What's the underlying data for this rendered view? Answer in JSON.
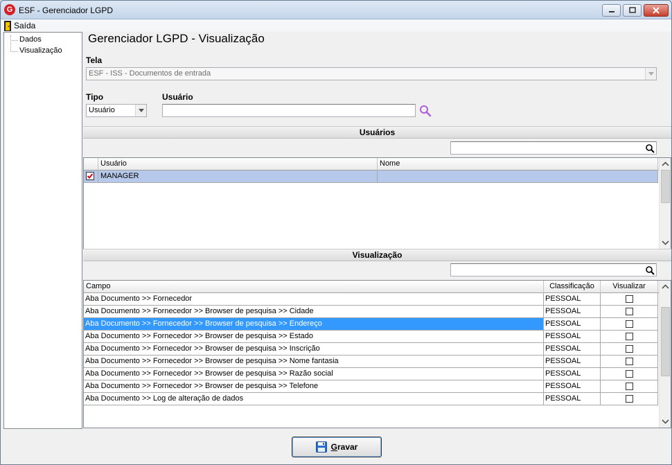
{
  "window": {
    "title": "ESF - Gerenciador LGPD",
    "app_icon_letter": "G"
  },
  "menu": {
    "exit_label": "Saída"
  },
  "tree": {
    "items": [
      {
        "label": "Dados"
      },
      {
        "label": "Visualização"
      }
    ]
  },
  "page": {
    "title": "Gerenciador LGPD - Visualização"
  },
  "form": {
    "tela_label": "Tela",
    "tela_value": "ESF - ISS - Documentos de entrada",
    "tipo_label": "Tipo",
    "tipo_value": "Usuário",
    "usuario_label": "Usuário",
    "usuario_value": ""
  },
  "users_section": {
    "title": "Usuários",
    "filter_value": "",
    "columns": [
      "Usuário",
      "Nome"
    ],
    "rows": [
      {
        "usuario": "MANAGER",
        "nome": "",
        "checked": true
      }
    ]
  },
  "view_section": {
    "title": "Visualização",
    "filter_value": "",
    "columns": [
      "Campo",
      "Classificação",
      "Visualizar"
    ],
    "rows": [
      {
        "campo": "Aba Documento >> Fornecedor",
        "classificacao": "PESSOAL",
        "visualizar": false
      },
      {
        "campo": "Aba Documento >> Fornecedor >> Browser de pesquisa >> Cidade",
        "classificacao": "PESSOAL",
        "visualizar": false
      },
      {
        "campo": "Aba Documento >> Fornecedor >> Browser de pesquisa >> Endereço",
        "classificacao": "PESSOAL",
        "visualizar": false
      },
      {
        "campo": "Aba Documento >> Fornecedor >> Browser de pesquisa >> Estado",
        "classificacao": "PESSOAL",
        "visualizar": false
      },
      {
        "campo": "Aba Documento >> Fornecedor >> Browser de pesquisa >> Inscrição",
        "classificacao": "PESSOAL",
        "visualizar": false
      },
      {
        "campo": "Aba Documento >> Fornecedor >> Browser de pesquisa >> Nome fantasia",
        "classificacao": "PESSOAL",
        "visualizar": false
      },
      {
        "campo": "Aba Documento >> Fornecedor >> Browser de pesquisa >> Razão social",
        "classificacao": "PESSOAL",
        "visualizar": false
      },
      {
        "campo": "Aba Documento >> Fornecedor >> Browser de pesquisa >> Telefone",
        "classificacao": "PESSOAL",
        "visualizar": false
      },
      {
        "campo": "Aba Documento >> Log de alteração de dados",
        "classificacao": "PESSOAL",
        "visualizar": false
      }
    ]
  },
  "actions": {
    "save_label": "Gravar",
    "save_accesskey": "G"
  },
  "colors": {
    "selection": "#3399ff",
    "selection_light": "#b7c9ea",
    "checkbox_red": "#d0021b",
    "search_icon_purple": "#b05fd6"
  },
  "icons": [
    "exit-door-icon",
    "search-icon",
    "magnifier-icon",
    "floppy-disk-icon",
    "checkbox-checked-icon",
    "checkbox-icon"
  ]
}
